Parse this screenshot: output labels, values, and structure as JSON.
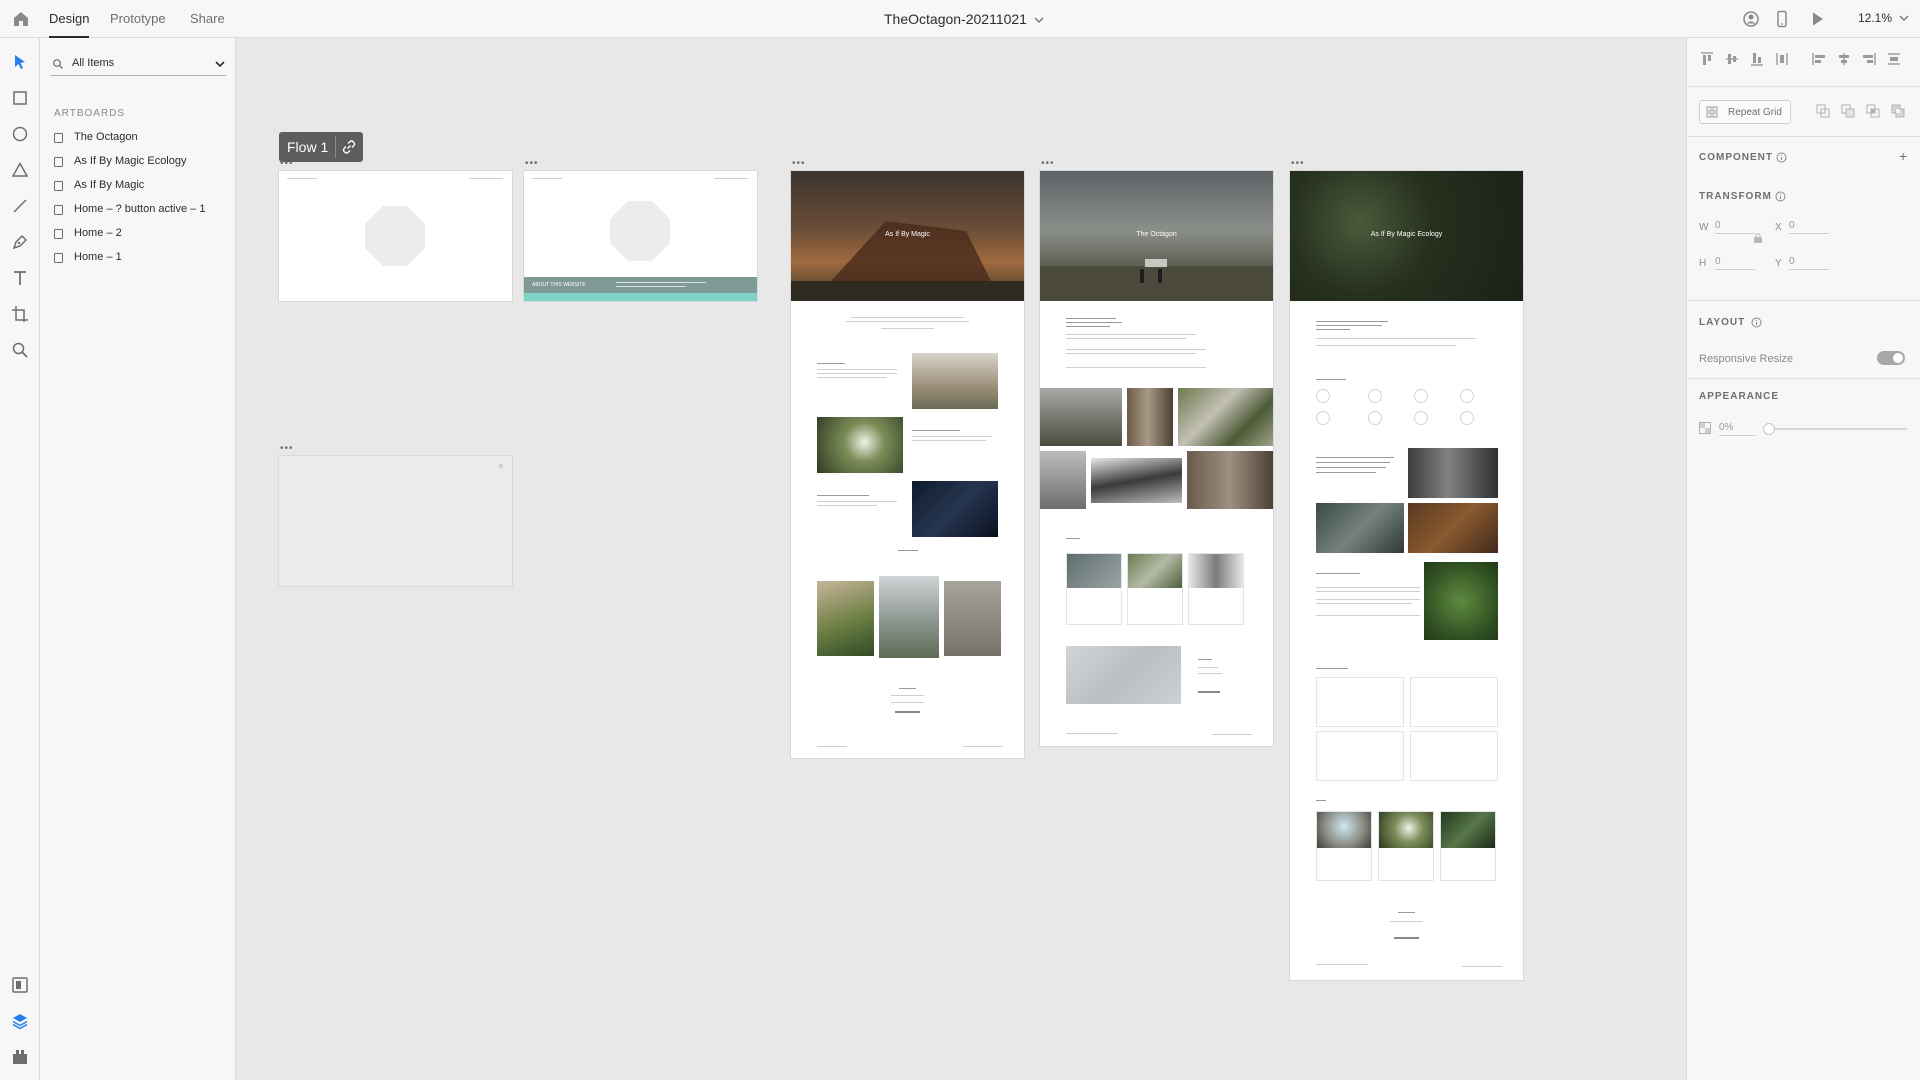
{
  "header": {
    "tabs": [
      {
        "label": "Design"
      },
      {
        "label": "Prototype"
      },
      {
        "label": "Share"
      }
    ],
    "document_title": "TheOctagon-20211021",
    "zoom": "12.1%"
  },
  "layers": {
    "filter_label": "All Items",
    "section_title": "ARTBOARDS",
    "artboards": [
      {
        "label": "The Octagon"
      },
      {
        "label": "As If By Magic Ecology"
      },
      {
        "label": "As If By Magic"
      },
      {
        "label": "Home – ? button active – 1"
      },
      {
        "label": "Home – 2"
      },
      {
        "label": "Home – 1"
      }
    ]
  },
  "canvas": {
    "flow_label": "Flow 1",
    "artboard_more": "•••",
    "about_label": "ABOUT THIS WEBSITE",
    "hero_titles": {
      "magic": "As If By Magic",
      "octagon": "The Octagon",
      "ecology": "As If By Magic Ecology"
    }
  },
  "properties": {
    "repeat_grid_label": "Repeat Grid",
    "component_title": "COMPONENT",
    "transform_title": "TRANSFORM",
    "w_label": "W",
    "w_value": "0",
    "x_label": "X",
    "x_value": "0",
    "h_label": "H",
    "h_value": "0",
    "y_label": "Y",
    "y_value": "0",
    "layout_title": "LAYOUT",
    "responsive_resize_label": "Responsive Resize",
    "responsive_resize_on": true,
    "appearance_title": "APPEARANCE",
    "opacity_value": "0%"
  },
  "colors": {
    "accent_teal": "#7dd4c6",
    "about_bar": "#7f9a95",
    "flow_badge": "#5d5d5d",
    "active_tool": "#2680eb"
  }
}
